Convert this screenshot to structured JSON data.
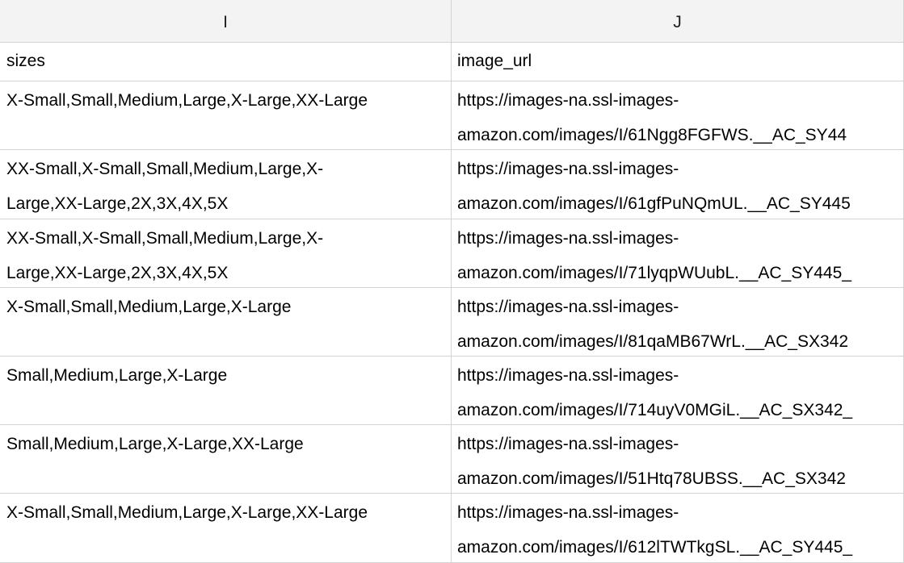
{
  "columns": [
    {
      "letter": "I"
    },
    {
      "letter": "J"
    }
  ],
  "rows": [
    {
      "sizes": [
        "sizes"
      ],
      "image_url": [
        "image_url"
      ]
    },
    {
      "sizes": [
        "X-Small,Small,Medium,Large,X-Large,XX-Large"
      ],
      "image_url": [
        "https://images-na.ssl-images-",
        "amazon.com/images/I/61Ngg8FGFWS.__AC_SY44"
      ]
    },
    {
      "sizes": [
        "XX-Small,X-Small,Small,Medium,Large,X-",
        "Large,XX-Large,2X,3X,4X,5X"
      ],
      "image_url": [
        "https://images-na.ssl-images-",
        "amazon.com/images/I/61gfPuNQmUL.__AC_SY445"
      ]
    },
    {
      "sizes": [
        "XX-Small,X-Small,Small,Medium,Large,X-",
        "Large,XX-Large,2X,3X,4X,5X"
      ],
      "image_url": [
        "https://images-na.ssl-images-",
        "amazon.com/images/I/71lyqpWUubL.__AC_SY445_"
      ]
    },
    {
      "sizes": [
        "X-Small,Small,Medium,Large,X-Large"
      ],
      "image_url": [
        "https://images-na.ssl-images-",
        "amazon.com/images/I/81qaMB67WrL.__AC_SX342"
      ]
    },
    {
      "sizes": [
        "Small,Medium,Large,X-Large"
      ],
      "image_url": [
        "https://images-na.ssl-images-",
        "amazon.com/images/I/714uyV0MGiL.__AC_SX342_"
      ]
    },
    {
      "sizes": [
        "Small,Medium,Large,X-Large,XX-Large"
      ],
      "image_url": [
        "https://images-na.ssl-images-",
        "amazon.com/images/I/51Htq78UBSS.__AC_SX342"
      ]
    },
    {
      "sizes": [
        "X-Small,Small,Medium,Large,X-Large,XX-Large"
      ],
      "image_url": [
        "https://images-na.ssl-images-",
        "amazon.com/images/I/612lTWTkgSL.__AC_SY445_"
      ]
    }
  ]
}
